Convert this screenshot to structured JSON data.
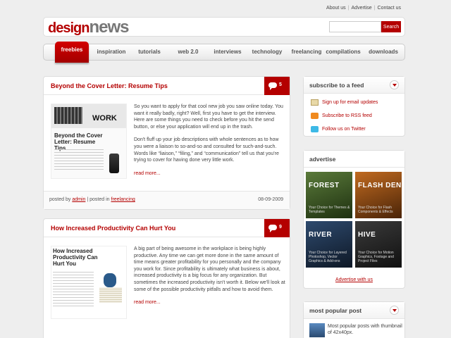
{
  "top_links": [
    "About us",
    "Advertise",
    "Contact us"
  ],
  "logo": {
    "part1": "design",
    "part2": "news"
  },
  "search": {
    "placeholder": "",
    "button": "Search"
  },
  "nav": [
    "freebies",
    "inspiration",
    "tutorials",
    "web 2.0",
    "interviews",
    "technology",
    "freelancing",
    "compilations",
    "downloads"
  ],
  "nav_active": "freebies",
  "posts": [
    {
      "title": "Beyond the Cover Letter: Resume Tips",
      "comments": "5",
      "thumb_title": "Beyond the Cover Letter: Resume Tips",
      "thumb_word": "WORK",
      "paragraphs": [
        "So you want to apply for that cool new job you saw online today. You want it really badly, right? Well, first you have to get the interview. Here are some things you need to check before you hit the send button, or else your application will end up in the trash.",
        "Don't fluff up your job descriptions with whole sentences as to how you were a liaison to so-and-so and consulted for such-and-such. Words like “liaison,” “filing,” and “communication” tell us that you're trying to cover for having done very little work."
      ],
      "read_more": "read more...",
      "posted_by": "posted by",
      "author": "admin",
      "posted_in": "posted in",
      "category": "freelancing",
      "date": "08-09-2009"
    },
    {
      "title": "How Increased Productivity Can Hurt You",
      "comments": "9",
      "thumb_title": "How Increased Productivity Can Hurt You",
      "paragraphs": [
        "A big part of being awesome in the workplace is being highly productive. Any time we can get more done in the same amount of time means greater profitability for you personally and the company you work for. Since profitability is ultimately what business is about, increased productivity is a big focus for any organization. But sometimes the increased productivity isn't worth it. Below we'll look at some of the possible productivity pitfalls and how to avoid them."
      ],
      "read_more": "read more..."
    }
  ],
  "sidebar": {
    "subscribe_title": "subscribe to a feed",
    "feeds": [
      {
        "label": "Sign up for email updates",
        "icon": "email-icon"
      },
      {
        "label": "Subscribe to RSS feed",
        "icon": "rss-icon"
      },
      {
        "label": "Follow us on Twitter",
        "icon": "twitter-icon"
      }
    ],
    "advertise_title": "advertise",
    "ads": [
      {
        "brand": "FOREST",
        "sub": "Your Choice for Themes & Templates",
        "color": "#3a5a2a"
      },
      {
        "brand": "FLASH DEN",
        "sub": "Your Choice for Flash Components & Effects",
        "color": "#8a4a18"
      },
      {
        "brand": "RIVER",
        "sub": "Your Choice for Layered Photoshop, Vector Graphics & Add-ons",
        "color": "#1f3148"
      },
      {
        "brand": "HIVE",
        "sub": "Your Choice for Motion Graphics, Footage and Project Files",
        "color": "#2b2b2b"
      }
    ],
    "advertise_link": "Advertise with us",
    "popular_title": "most popular post",
    "popular_text": "Most popular posts with thumbnail of 42x40px."
  }
}
